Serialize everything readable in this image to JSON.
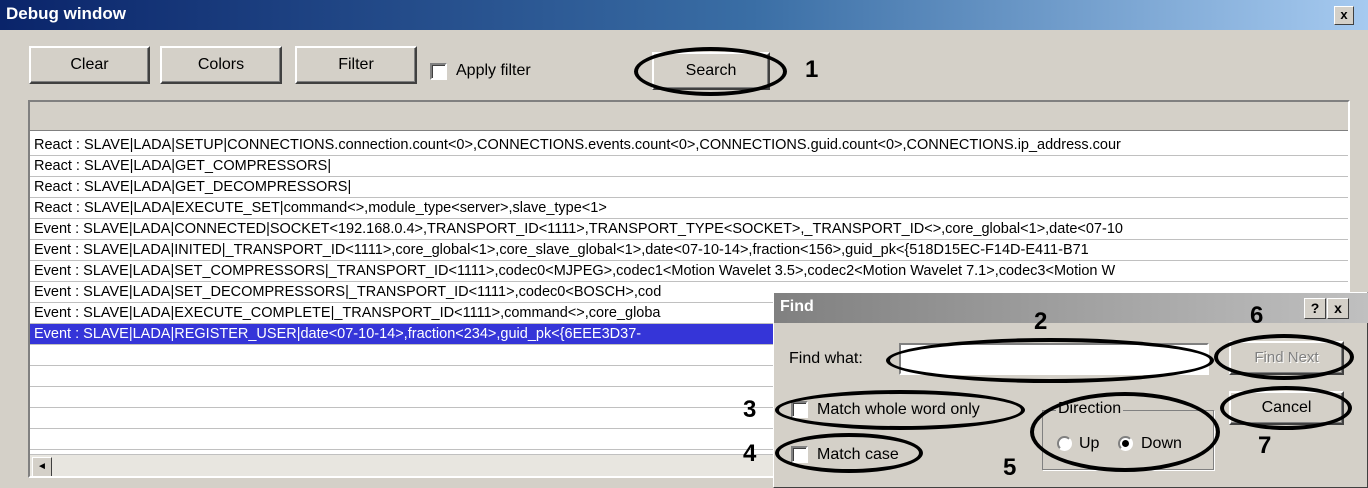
{
  "window": {
    "title": "Debug window",
    "close_glyph": "x"
  },
  "toolbar": {
    "clear": "Clear",
    "colors": "Colors",
    "filter": "Filter",
    "apply_filter": "Apply filter",
    "search": "Search"
  },
  "log": {
    "rows": [
      "React : SLAVE|LADA|SETUP|CONNECTIONS.connection.count<0>,CONNECTIONS.events.count<0>,CONNECTIONS.guid.count<0>,CONNECTIONS.ip_address.cour",
      "React : SLAVE|LADA|GET_COMPRESSORS|",
      "React : SLAVE|LADA|GET_DECOMPRESSORS|",
      "React : SLAVE|LADA|EXECUTE_SET|command<>,module_type<server>,slave_type<1>",
      "Event : SLAVE|LADA|CONNECTED|SOCKET<192.168.0.4>,TRANSPORT_ID<1111>,TRANSPORT_TYPE<SOCKET>,_TRANSPORT_ID<>,core_global<1>,date<07-10",
      "Event : SLAVE|LADA|INITED|_TRANSPORT_ID<1111>,core_global<1>,core_slave_global<1>,date<07-10-14>,fraction<156>,guid_pk<{518D15EC-F14D-E411-B71",
      "Event : SLAVE|LADA|SET_COMPRESSORS|_TRANSPORT_ID<1111>,codec0<MJPEG>,codec1<Motion Wavelet 3.5>,codec2<Motion Wavelet 7.1>,codec3<Motion W",
      "Event : SLAVE|LADA|SET_DECOMPRESSORS|_TRANSPORT_ID<1111>,codec0<BOSCH>,cod",
      "Event : SLAVE|LADA|EXECUTE_COMPLETE|_TRANSPORT_ID<1111>,command<>,core_globa",
      "Event : SLAVE|LADA|REGISTER_USER|date<07-10-14>,fraction<234>,guid_pk<{6EEE3D37-"
    ],
    "scroll_left": "◄"
  },
  "find": {
    "title": "Find",
    "help": "?",
    "close": "x",
    "find_what_label": "Find what:",
    "find_what_value": "",
    "find_next": "Find Next",
    "cancel": "Cancel",
    "match_whole_word": "Match whole word only",
    "match_case": "Match case",
    "direction_label": "Direction",
    "up": "Up",
    "down": "Down"
  },
  "callouts": {
    "n1": "1",
    "n2": "2",
    "n3": "3",
    "n4": "4",
    "n5": "5",
    "n6": "6",
    "n7": "7"
  }
}
